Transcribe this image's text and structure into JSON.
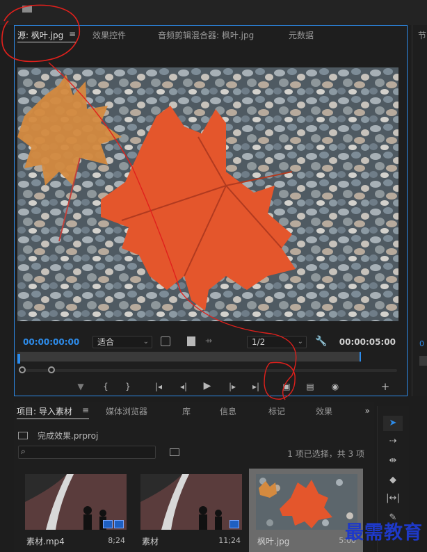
{
  "source_panel": {
    "tabs": [
      {
        "label": "源: 枫叶.jpg",
        "active": true
      },
      {
        "label": "效果控件"
      },
      {
        "label": "音频剪辑混合器: 枫叶.jpg"
      },
      {
        "label": "元数据"
      }
    ],
    "menu_icon": "≡",
    "timecode_current": "00:00:00:00",
    "fit_select": "适合",
    "resolution_select": "1/2",
    "timecode_duration": "00:00:05:00",
    "preview_image": "maple-leaves-on-pebbles",
    "transport_icons": [
      "marker-icon",
      "mark-in-icon",
      "mark-out-icon",
      "go-to-in-icon",
      "step-back-icon",
      "play-icon",
      "step-forward-icon",
      "go-to-out-icon",
      "insert-icon",
      "overwrite-icon",
      "export-frame-icon",
      "add-button-icon"
    ]
  },
  "right_stub": {
    "tab_label": "节",
    "timecode": "0"
  },
  "project_panel": {
    "tabs": [
      {
        "label": "项目: 导入素材",
        "active": true
      },
      {
        "label": "媒体浏览器"
      },
      {
        "label": "库"
      },
      {
        "label": "信息"
      },
      {
        "label": "标记"
      },
      {
        "label": "效果"
      }
    ],
    "overflow_icon": "»",
    "project_file": "完成效果.prproj",
    "search_icon": "⌕",
    "selection_info": "1 项已选择，共 3 项",
    "items": [
      {
        "name": "素材.mp4",
        "duration": "8;24",
        "thumb": "video-road-shadows"
      },
      {
        "name": "素材",
        "duration": "11;24",
        "thumb": "video-road-shadows"
      },
      {
        "name": "枫叶.jpg",
        "duration": "5:00",
        "thumb": "maple-leaf",
        "selected": true
      }
    ]
  },
  "tools": [
    "selection-tool-icon",
    "track-select-icon",
    "ripple-edit-icon",
    "razor-icon",
    "slip-icon",
    "pen-icon"
  ],
  "watermark": "最需教育",
  "colors": {
    "accent": "#2d8ceb",
    "annotation": "#e0201c",
    "watermark": "#1e39c8"
  }
}
